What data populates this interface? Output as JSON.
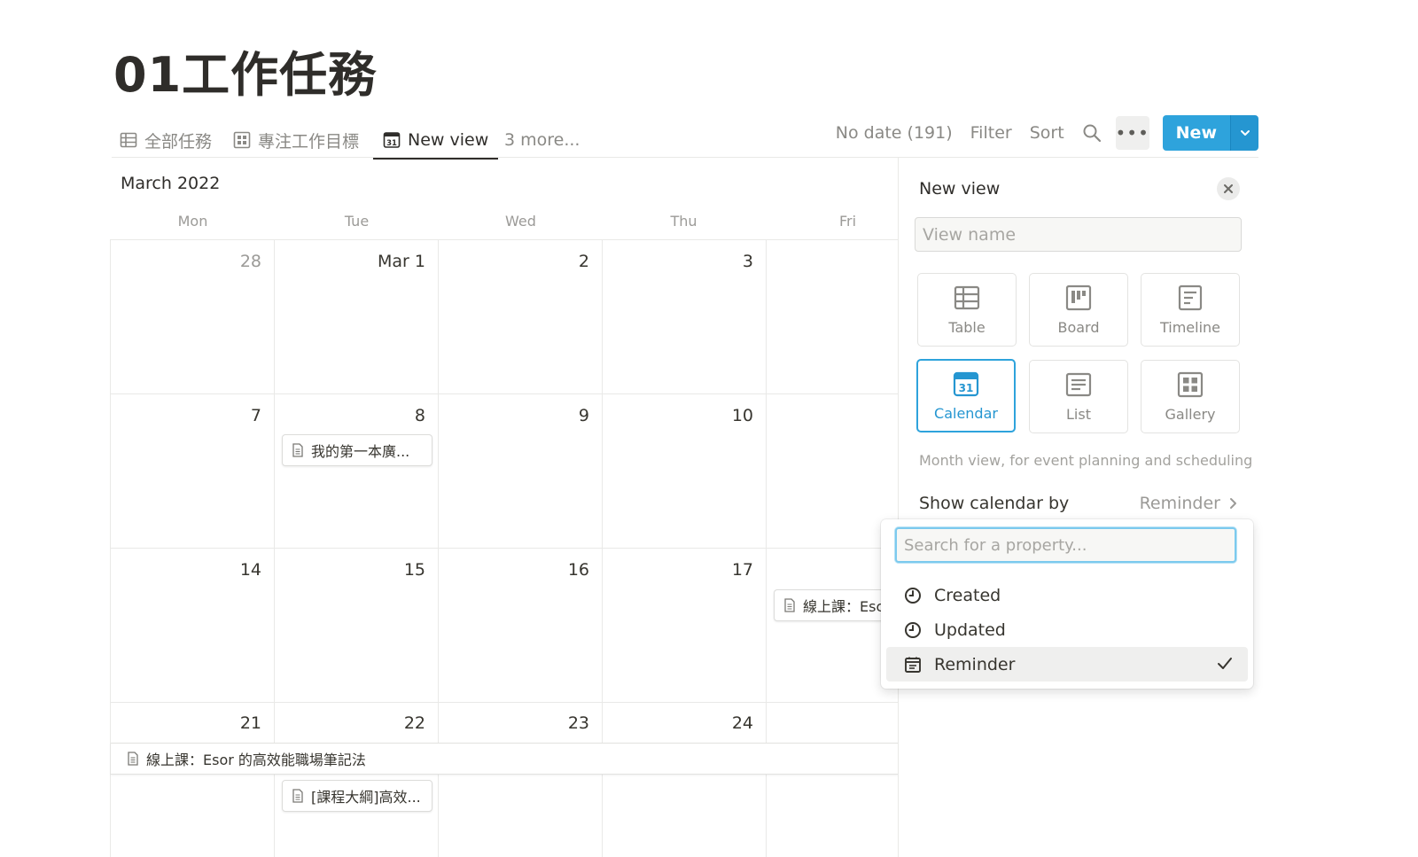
{
  "page": {
    "title": "01工作任務"
  },
  "tabs": [
    {
      "label": "全部任務"
    },
    {
      "label": "專注工作目標"
    },
    {
      "label": "New view"
    },
    {
      "label": "3 more..."
    }
  ],
  "toolbar": {
    "no_date": "No date (191)",
    "filter": "Filter",
    "sort": "Sort",
    "more": "•••",
    "new_label": "New"
  },
  "calendar": {
    "month": "March 2022",
    "weekdays": [
      "Mon",
      "Tue",
      "Wed",
      "Thu",
      "Fri"
    ],
    "weeks": [
      [
        "28",
        "Mar 1",
        "2",
        "3",
        ""
      ],
      [
        "7",
        "8",
        "9",
        "10",
        ""
      ],
      [
        "14",
        "15",
        "16",
        "17",
        ""
      ],
      [
        "21",
        "22",
        "23",
        "24",
        ""
      ]
    ],
    "events": {
      "tue8": "我的第一本廣...",
      "fri17": "線上課：Esc",
      "wide21": "線上課：Esor 的高效能職場筆記法",
      "tue22": "[課程大綱]高效..."
    }
  },
  "panel": {
    "title": "New view",
    "name_placeholder": "View name",
    "types": [
      {
        "label": "Table",
        "icon": "table-icon"
      },
      {
        "label": "Board",
        "icon": "board-icon"
      },
      {
        "label": "Timeline",
        "icon": "timeline-icon"
      },
      {
        "label": "Calendar",
        "icon": "calendar-icon",
        "selected": true
      },
      {
        "label": "List",
        "icon": "list-icon"
      },
      {
        "label": "Gallery",
        "icon": "gallery-icon"
      }
    ],
    "calendar_badge": "31",
    "description": "Month view, for event planning and scheduling",
    "show_by_label": "Show calendar by",
    "show_by_value": "Reminder"
  },
  "dropdown": {
    "search_placeholder": "Search for a property...",
    "options": [
      {
        "label": "Created",
        "icon": "clock-icon"
      },
      {
        "label": "Updated",
        "icon": "clock-icon"
      },
      {
        "label": "Reminder",
        "icon": "calendar-icon",
        "checked": true
      }
    ]
  },
  "colors": {
    "accent": "#2ea3dc",
    "text": "#37352f",
    "muted": "#9b9a97",
    "border": "#e9e9e7"
  }
}
